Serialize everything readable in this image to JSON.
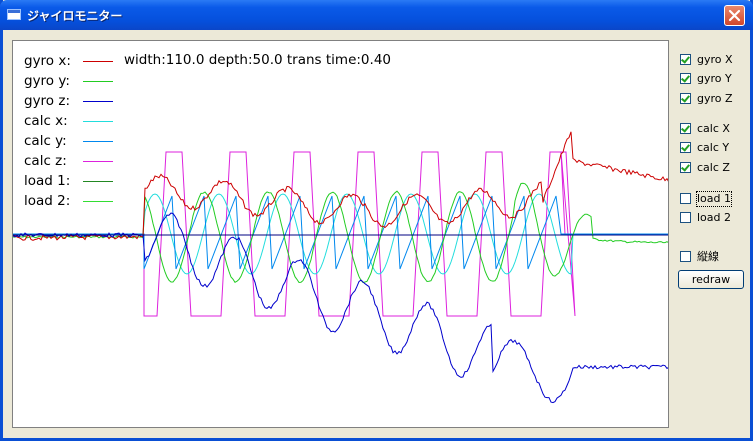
{
  "window": {
    "title": "ジャイロモニター"
  },
  "params": "width:110.0 depth:50.0 trans time:0.40",
  "legend": [
    {
      "label": "gyro x:",
      "color": "#cc0000"
    },
    {
      "label": "gyro y:",
      "color": "#22cc22"
    },
    {
      "label": "gyro z:",
      "color": "#0000cc"
    },
    {
      "label": "calc x:",
      "color": "#22dddd"
    },
    {
      "label": "calc y:",
      "color": "#0088ee"
    },
    {
      "label": "calc z:",
      "color": "#dd22dd"
    },
    {
      "label": "load 1:",
      "color": "#228822"
    },
    {
      "label": "load 2:",
      "color": "#33dd33"
    }
  ],
  "checkboxes": [
    {
      "label": "gyro X",
      "checked": true
    },
    {
      "label": "gyro Y",
      "checked": true
    },
    {
      "label": "gyro Z",
      "checked": true
    },
    {
      "label": "calc X",
      "checked": true
    },
    {
      "label": "calc Y",
      "checked": true
    },
    {
      "label": "calc Z",
      "checked": true
    },
    {
      "label": "load 1",
      "checked": false
    },
    {
      "label": "load 2",
      "checked": false
    },
    {
      "label": "縦線",
      "checked": false
    }
  ],
  "redraw_label": "redraw"
}
